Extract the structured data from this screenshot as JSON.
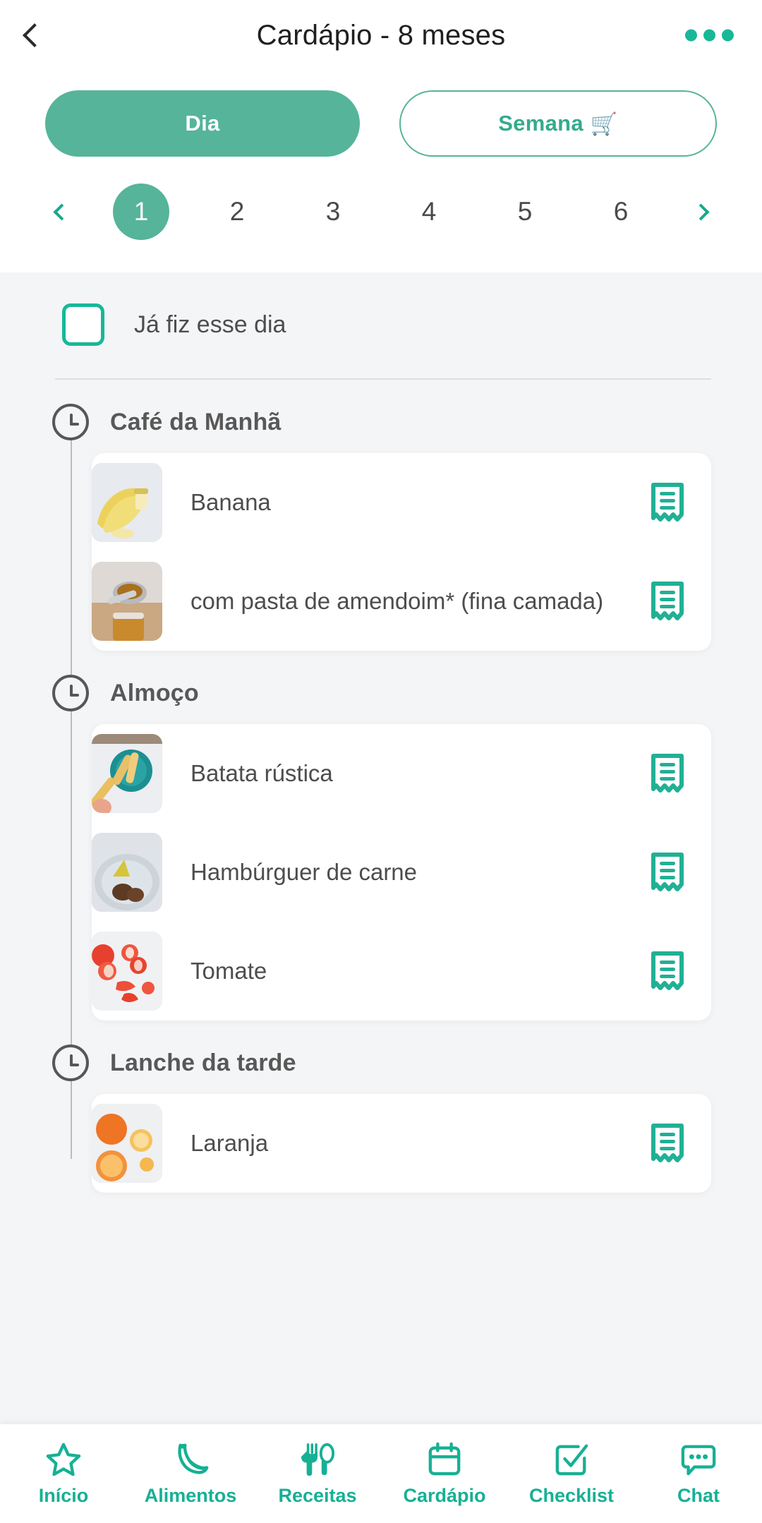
{
  "theme": {
    "accent": "#17b094",
    "accent_solid": "#55b49a",
    "text_dark": "#4d4d4d",
    "bg": "#f4f5f7"
  },
  "header": {
    "title": "Cardápio - 8 meses",
    "back_icon": "chevron-left-icon",
    "menu_icon": "more-options-icon"
  },
  "view_toggle": {
    "day_label": "Dia",
    "week_label": "Semana",
    "week_emoji": "🛒",
    "selected": "Dia"
  },
  "day_pager": {
    "prev_icon": "chevron-left-icon",
    "next_icon": "chevron-right-icon",
    "days": [
      "1",
      "2",
      "3",
      "4",
      "5",
      "6"
    ],
    "selected_day": "1"
  },
  "done_checkbox": {
    "label": "Já fiz esse dia",
    "checked": false
  },
  "meals": [
    {
      "title": "Café da Manhã",
      "icon": "clock-icon",
      "items": [
        {
          "name": "Banana",
          "thumb": "banana-photo",
          "recipe_icon": "recipe-receipt-icon"
        },
        {
          "name": "com pasta de amendoim* (fina camada)",
          "thumb": "peanut-butter-photo",
          "recipe_icon": "recipe-receipt-icon"
        }
      ]
    },
    {
      "title": "Almoço",
      "icon": "clock-icon",
      "items": [
        {
          "name": "Batata rústica",
          "thumb": "potato-photo",
          "recipe_icon": "recipe-receipt-icon"
        },
        {
          "name": "Hambúrguer de carne",
          "thumb": "burger-photo",
          "recipe_icon": "recipe-receipt-icon"
        },
        {
          "name": "Tomate",
          "thumb": "tomato-photo",
          "recipe_icon": "recipe-receipt-icon"
        }
      ]
    },
    {
      "title": "Lanche da tarde",
      "icon": "clock-icon",
      "items": [
        {
          "name": "Laranja",
          "thumb": "orange-photo",
          "recipe_icon": "recipe-receipt-icon"
        }
      ]
    }
  ],
  "bottom_nav": [
    {
      "label": "Início",
      "icon": "star-icon"
    },
    {
      "label": "Alimentos",
      "icon": "banana-icon"
    },
    {
      "label": "Receitas",
      "icon": "fork-spoon-icon"
    },
    {
      "label": "Cardápio",
      "icon": "calendar-icon"
    },
    {
      "label": "Checklist",
      "icon": "checkbox-check-icon"
    },
    {
      "label": "Chat",
      "icon": "chat-bubble-icon"
    }
  ]
}
